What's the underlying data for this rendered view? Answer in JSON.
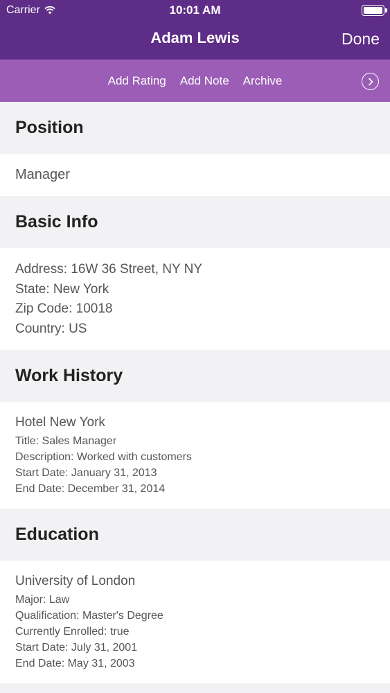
{
  "status": {
    "carrier": "Carrier",
    "time": "10:01 AM",
    "icons": {
      "wifi": "wifi-icon",
      "battery": "battery-icon"
    }
  },
  "nav": {
    "title": "Adam Lewis",
    "done_label": "Done"
  },
  "toolbar": {
    "actions": [
      "Add Rating",
      "Add Note",
      "Archive"
    ],
    "more_icon": "chevron-right-circle-icon"
  },
  "colors": {
    "nav_bg": "#5e2d87",
    "toolbar_bg": "#9b5db5",
    "section_bg": "#f2f2f4"
  },
  "sections": {
    "position": {
      "title": "Position",
      "value": "Manager"
    },
    "basic_info": {
      "title": "Basic Info",
      "lines": [
        "Address: 16W 36 Street, NY NY",
        "State: New York",
        "Zip Code: 10018",
        "Country: US"
      ]
    },
    "work_history": {
      "title": "Work History",
      "entries": [
        {
          "name": "Hotel New York",
          "lines": [
            "Title: Sales Manager",
            "Description: Worked with customers",
            "Start Date: January 31, 2013",
            "End Date: December 31, 2014"
          ]
        }
      ]
    },
    "education": {
      "title": "Education",
      "entries": [
        {
          "name": "University of London",
          "lines": [
            "Major: Law",
            "Qualification: Master's Degree",
            "Currently Enrolled: true",
            "Start Date: July 31, 2001",
            "End Date: May 31, 2003"
          ]
        }
      ]
    }
  }
}
